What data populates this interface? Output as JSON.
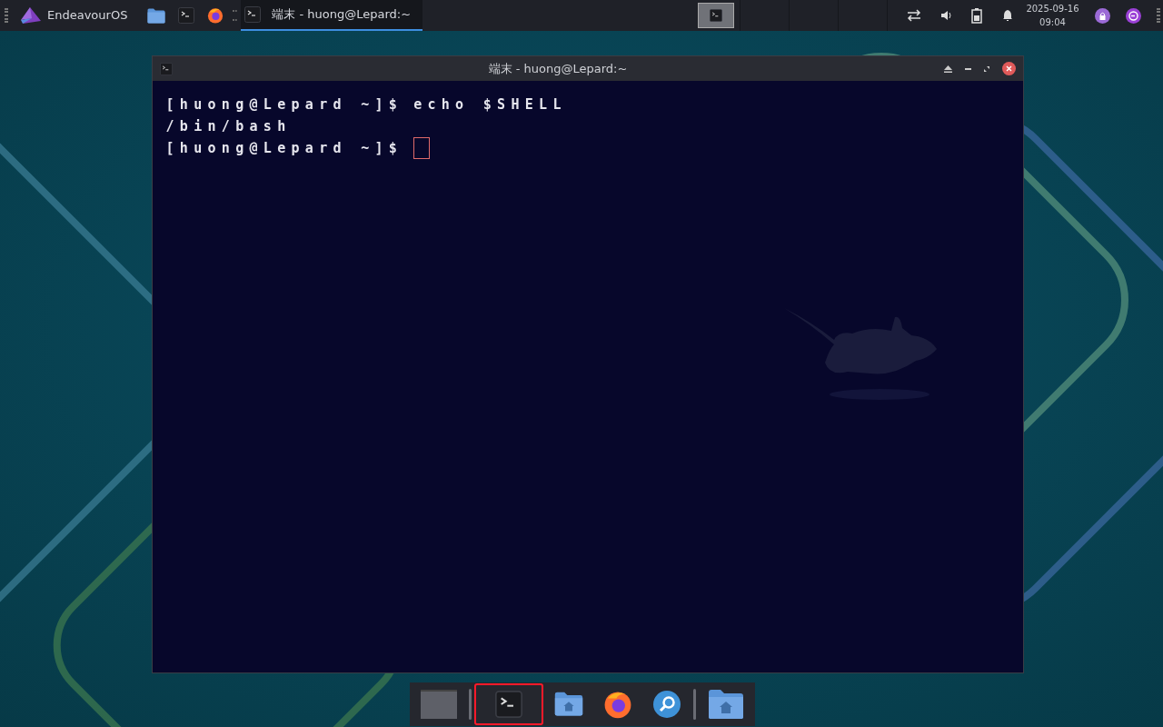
{
  "top_panel": {
    "menu_label": "EndeavourOS",
    "launchers": [
      {
        "kind": "folder"
      },
      {
        "kind": "terminal"
      },
      {
        "kind": "browser"
      }
    ],
    "tasks": [
      {
        "title": "端末 - huong@Lepard:~",
        "selected": true
      }
    ],
    "workspaces": [
      {
        "selected": true
      },
      {
        "selected": false
      },
      {
        "selected": false
      },
      {
        "selected": false
      }
    ],
    "clock": {
      "date": "2025-09-16",
      "time": "09:04"
    }
  },
  "window": {
    "title": "端末 - huong@Lepard:~",
    "lines": [
      {
        "prompt": "[huong@Lepard ~]$",
        "command": "echo $SHELL"
      },
      {
        "output": "/bin/bash"
      },
      {
        "prompt": "[huong@Lepard ~]$",
        "cursor": true
      }
    ]
  },
  "dock": {
    "items": [
      {
        "kind": "desktop",
        "selected": false
      },
      {
        "kind": "separator"
      },
      {
        "kind": "terminal",
        "selected": true
      },
      {
        "kind": "home",
        "selected": false
      },
      {
        "kind": "browser",
        "selected": false
      },
      {
        "kind": "search",
        "selected": false
      },
      {
        "kind": "separator"
      },
      {
        "kind": "folder",
        "selected": false
      }
    ]
  }
}
